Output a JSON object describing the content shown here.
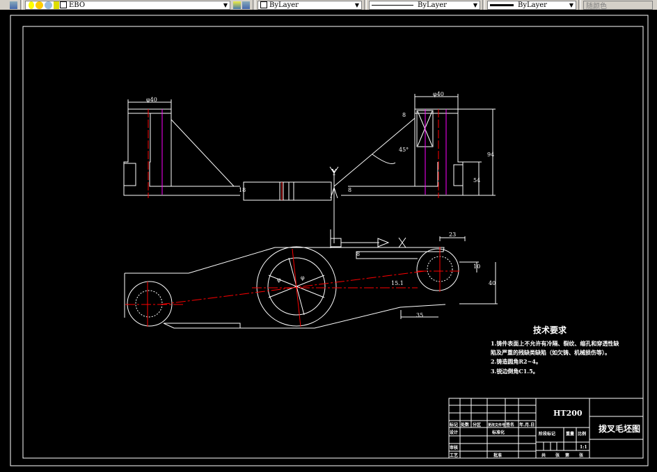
{
  "toolbar": {
    "layer_name": "EBO",
    "color": "ByLayer",
    "linetype": "ByLayer",
    "lineweight": "ByLayer",
    "plot_style": "随颜色",
    "icons": [
      "layer-manager-icon",
      "lightbulb-icon",
      "sun-icon",
      "freeze-icon",
      "lock-icon",
      "make-current-layer-icon",
      "layer-previous-icon"
    ]
  },
  "colors": {
    "background": "#000000",
    "lines": "#ffffff",
    "centerline": "#ff0000",
    "hidden": "#ff00ff"
  },
  "drawing": {
    "top_view_dims": {
      "left_width": "φ40",
      "right_width": "φ40",
      "chamfer": "8",
      "angle": "45°",
      "overall_height": "94",
      "boss_height": "54",
      "bore": "18",
      "slot": "8"
    },
    "datum_y": "Y",
    "datum_x": "X",
    "plan_view_dims": {
      "top_offset": "23",
      "slot": "8",
      "right_offset": "10",
      "right_height": "40",
      "bottom_width": "35",
      "center_offset": "15.1",
      "dia_a": "φ",
      "dia_b": "φ"
    }
  },
  "notes": {
    "title": "技术要求",
    "lines": [
      "1.铸件表面上不允许有冷隔、裂纹、缩孔和穿透性缺",
      "陷及严重的残缺类缺陷（如欠铸、机械损伤等）。",
      "2.铸造圆角R2~4。",
      "3.锐边倒角C1.5。"
    ]
  },
  "title_block": {
    "material": "HT200",
    "drawing_title": "拨叉毛坯图",
    "headers": [
      "标记",
      "处数",
      "分区",
      "更改文件号",
      "签名",
      "年.月.日"
    ],
    "design": "设计",
    "standardization": "标准化",
    "review": "审核",
    "process": "工艺",
    "approve": "批准",
    "stage_mark": "阶段标记",
    "weight": "重量",
    "scale_label": "比例",
    "scale": "1:1",
    "sheets": [
      "共",
      "张",
      "第",
      "张"
    ]
  }
}
